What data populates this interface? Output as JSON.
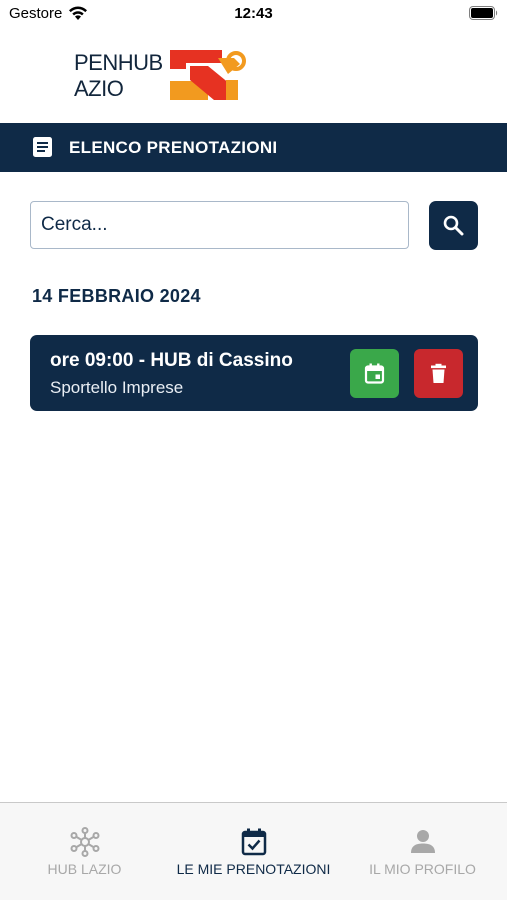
{
  "status_bar": {
    "carrier": "Gestore",
    "time": "12:43"
  },
  "logo": {
    "line1": "PENHUB",
    "line2": "AZIO"
  },
  "section": {
    "title": "ELENCO PRENOTAZIONI",
    "icon": "document-list-icon"
  },
  "search": {
    "placeholder": "Cerca...",
    "value": "",
    "icon": "search-icon"
  },
  "date_heading": "14 FEBBRAIO 2024",
  "bookings": [
    {
      "title": "ore 09:00 - HUB di Cassino",
      "subtitle": "Sportello Imprese",
      "actions": [
        {
          "icon": "calendar-icon",
          "color": "#3aa84a"
        },
        {
          "icon": "trash-icon",
          "color": "#c8282d"
        }
      ]
    }
  ],
  "tab_bar": {
    "tabs": [
      {
        "label": "HUB LAZIO",
        "icon": "network-icon",
        "active": false
      },
      {
        "label": "LE MIE PRENOTAZIONI",
        "icon": "calendar-check-icon",
        "active": true
      },
      {
        "label": "IL MIO PROFILO",
        "icon": "user-icon",
        "active": false
      }
    ]
  },
  "colors": {
    "primary": "#0f2a47",
    "success": "#3aa84a",
    "danger": "#c8282d",
    "logo_red": "#e63222",
    "logo_orange": "#f29a1f"
  }
}
